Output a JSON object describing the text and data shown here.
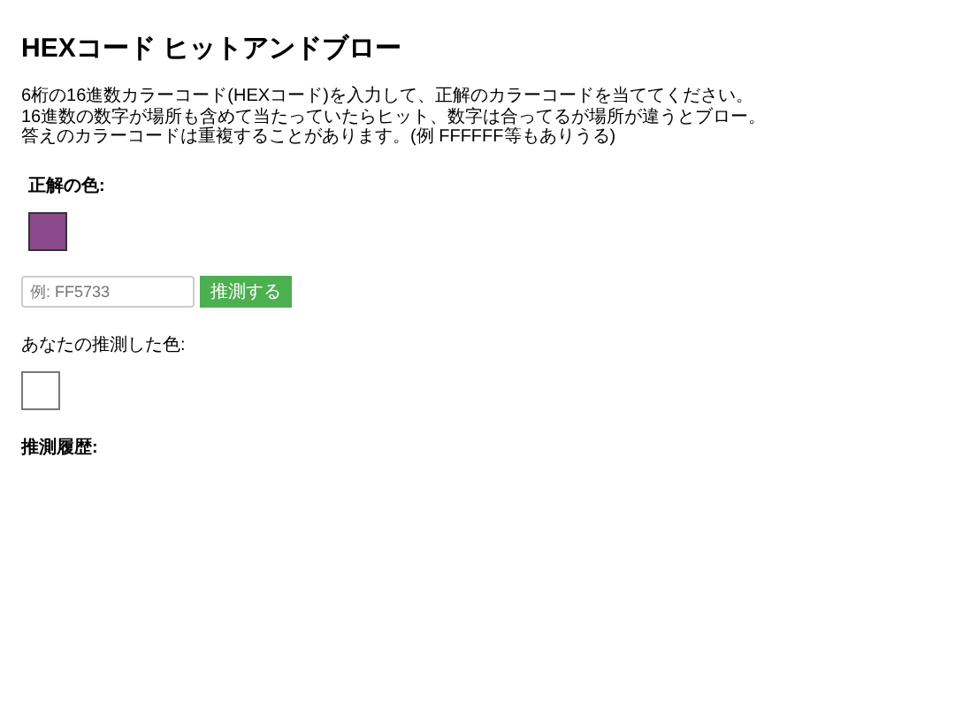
{
  "title": "HEXコード ヒットアンドブロー",
  "description": [
    "6桁の16進数カラーコード(HEXコード)を入力して、正解のカラーコードを当ててください。",
    "16進数の数字が場所も含めて当たっていたらヒット、数字は合ってるが場所が違うとブロー。",
    "答えのカラーコードは重複することがあります。(例 FFFFFF等もありうる)"
  ],
  "answer": {
    "label": "正解の色:",
    "color": "#8b4a8c"
  },
  "guess_input": {
    "placeholder": "例: FF5733"
  },
  "guess_button": "推測する",
  "guess_color": {
    "label": "あなたの推測した色:"
  },
  "history": {
    "label": "推測履歴:"
  }
}
